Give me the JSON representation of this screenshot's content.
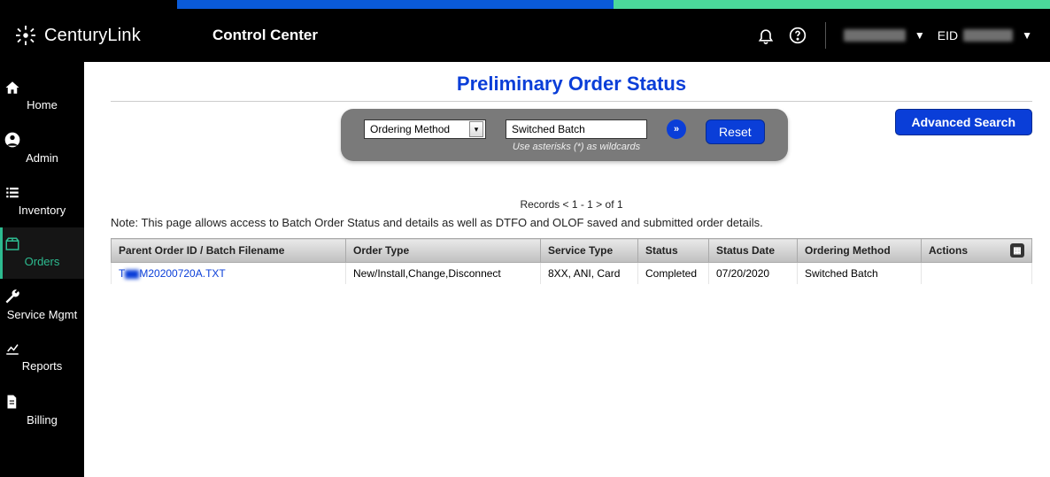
{
  "header": {
    "brand": "CenturyLink",
    "product": "Control Center",
    "eid_label": "EID"
  },
  "sidebar": {
    "items": [
      {
        "key": "home",
        "label": "Home"
      },
      {
        "key": "admin",
        "label": "Admin"
      },
      {
        "key": "inventory",
        "label": "Inventory"
      },
      {
        "key": "orders",
        "label": "Orders"
      },
      {
        "key": "service",
        "label": "Service Mgmt"
      },
      {
        "key": "reports",
        "label": "Reports"
      },
      {
        "key": "billing",
        "label": "Billing"
      }
    ]
  },
  "page": {
    "title": "Preliminary Order Status",
    "filter_select_value": "Ordering Method",
    "filter_text_value": "Switched Batch",
    "wildcard_hint": "Use asterisks (*) as wildcards",
    "reset_label": "Reset",
    "advanced_label": "Advanced Search",
    "records_text": "Records < 1 - 1 >    of    1",
    "note": "Note: This page allows access to Batch Order Status and details as well as DTFO and OLOF saved and submitted order details."
  },
  "table": {
    "columns": [
      "Parent Order ID / Batch Filename",
      "Order Type",
      "Service Type",
      "Status",
      "Status Date",
      "Ordering Method",
      "Actions"
    ],
    "rows": [
      {
        "filename_prefix": "T",
        "filename_suffix": "M20200720A.TXT",
        "order_type": "New/Install,Change,Disconnect",
        "service_type": "8XX, ANI, Card",
        "status": "Completed",
        "status_date": "07/20/2020",
        "ordering_method": "Switched Batch",
        "actions": ""
      }
    ]
  }
}
